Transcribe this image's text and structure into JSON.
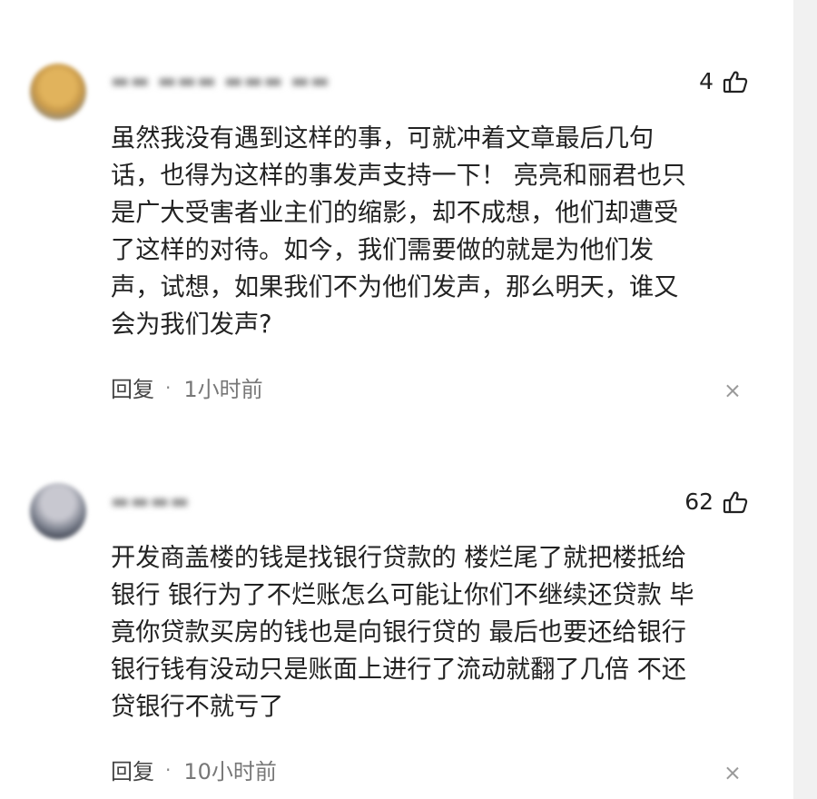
{
  "comments": [
    {
      "username": "",
      "likes": "4",
      "text_lines": [
        "虽然我没有遇到这样的事，可就冲着文章最后几句",
        "话，也得为这样的事发声支持一下！ 亮亮和丽君也只",
        "是广大受害者业主们的缩影，却不成想，他们却遭受",
        "了这样的对待。如今，我们需要做的就是为他们发",
        "声，试想，如果我们不为他们发声，那么明天，谁又",
        "会为我们发声?"
      ],
      "reply_label": "回复",
      "separator": "·",
      "time": "1小时前"
    },
    {
      "username": "",
      "likes": "62",
      "text_lines": [
        "开发商盖楼的钱是找银行贷款的 楼烂尾了就把楼抵给",
        "银行 银行为了不烂账怎么可能让你们不继续还贷款 毕",
        "竟你贷款买房的钱也是向银行贷的 最后也要还给银行",
        "银行钱有没动只是账面上进行了流动就翻了几倍 不还",
        "贷银行不就亏了"
      ],
      "reply_label": "回复",
      "separator": "·",
      "time": "10小时前"
    }
  ],
  "icons": {
    "like": "thumbs-up-icon",
    "close": "close-icon"
  },
  "colors": {
    "text": "#222222",
    "meta": "#777777",
    "scrollbar": "#f1f1f1"
  }
}
